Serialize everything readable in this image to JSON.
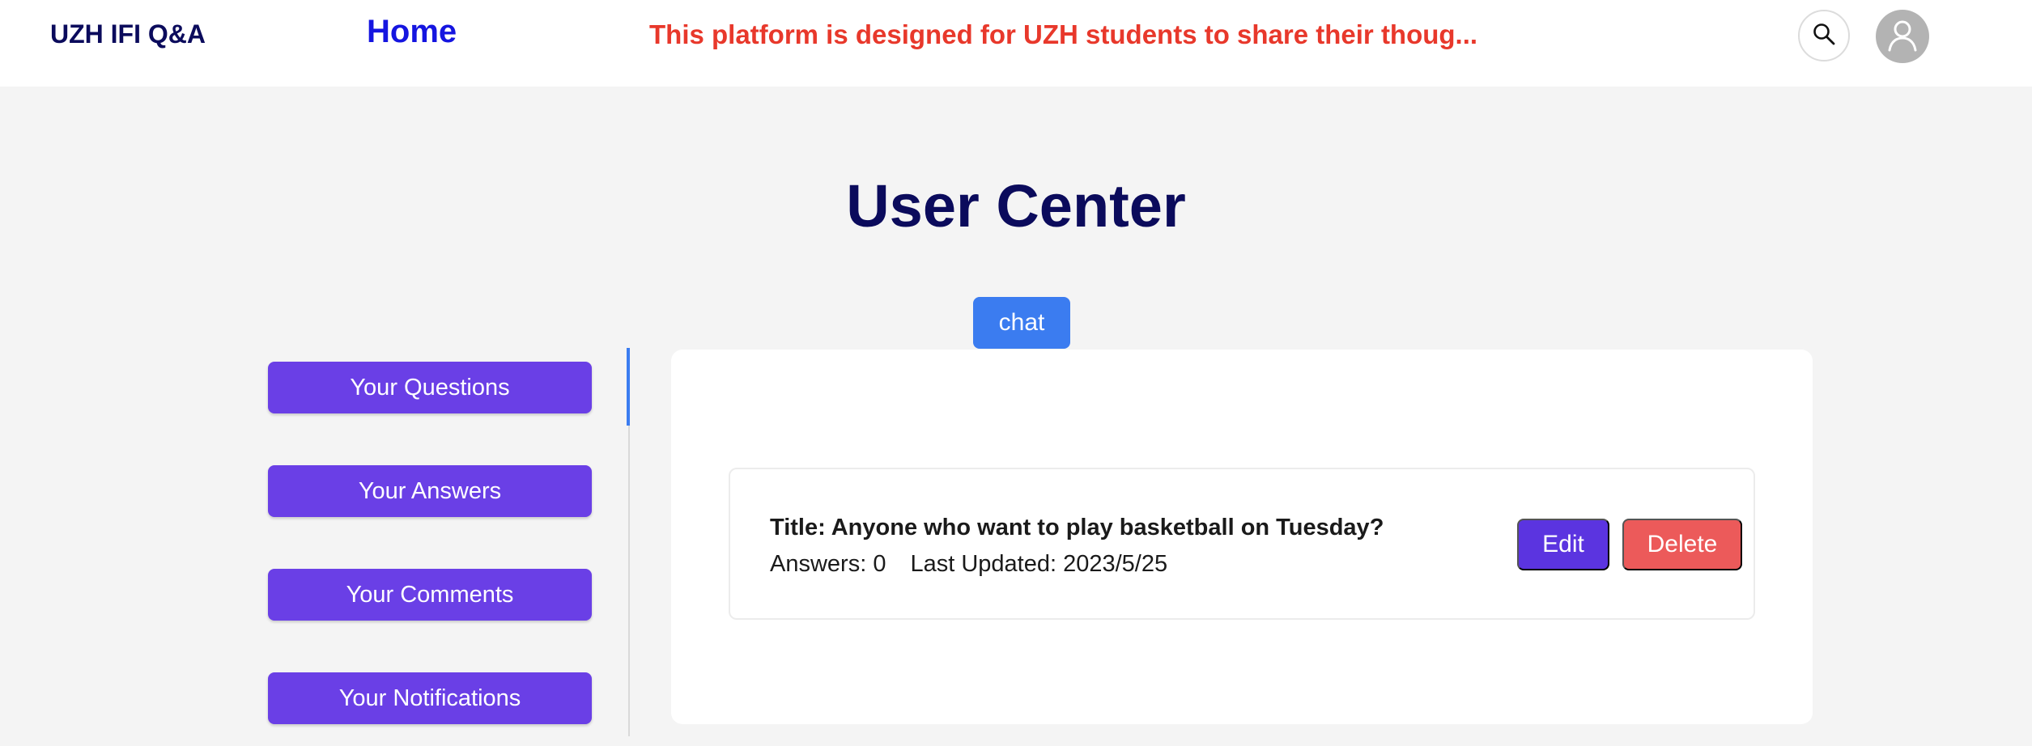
{
  "header": {
    "brand": "UZH IFI Q&A",
    "home_label": "Home",
    "banner": "This platform is designed for UZH students to share their thoug...",
    "search_icon": "search-icon",
    "avatar_icon": "user-icon"
  },
  "main": {
    "title": "User Center",
    "chat_label": "chat"
  },
  "sidebar": {
    "items": [
      {
        "label": "Your Questions",
        "active": true
      },
      {
        "label": "Your Answers"
      },
      {
        "label": "Your Comments"
      },
      {
        "label": "Your Notifications"
      }
    ]
  },
  "question": {
    "title": "Title: Anyone who want to play basketball on Tuesday?",
    "answers": "Answers: 0",
    "last_updated": "Last Updated: 2023/5/25",
    "edit_label": "Edit",
    "delete_label": "Delete"
  },
  "colors": {
    "brand": "#0b0b5c",
    "home_link": "#1515e0",
    "banner": "#e8382b",
    "sidebar_button": "#6a3fe6",
    "chat_button": "#3b7cf0",
    "edit_button": "#5b34e0",
    "delete_button": "#ec5a5a"
  }
}
